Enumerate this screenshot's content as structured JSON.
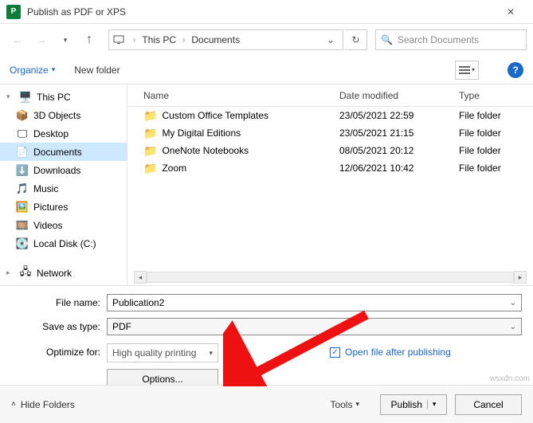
{
  "title": "Publish as PDF or XPS",
  "breadcrumb": {
    "root": "This PC",
    "folder": "Documents"
  },
  "search": {
    "placeholder": "Search Documents"
  },
  "toolbar": {
    "organize": "Organize",
    "newfolder": "New folder"
  },
  "sidebar": {
    "root": "This PC",
    "items": [
      "3D Objects",
      "Desktop",
      "Documents",
      "Downloads",
      "Music",
      "Pictures",
      "Videos",
      "Local Disk (C:)"
    ],
    "network": "Network"
  },
  "columns": {
    "name": "Name",
    "date": "Date modified",
    "type": "Type"
  },
  "files": [
    {
      "name": "Custom Office Templates",
      "date": "23/05/2021 22:59",
      "type": "File folder"
    },
    {
      "name": "My Digital Editions",
      "date": "23/05/2021 21:15",
      "type": "File folder"
    },
    {
      "name": "OneNote Notebooks",
      "date": "08/05/2021 20:12",
      "type": "File folder"
    },
    {
      "name": "Zoom",
      "date": "12/06/2021 10:42",
      "type": "File folder"
    }
  ],
  "form": {
    "filename_label": "File name:",
    "filename_value": "Publication2",
    "saveas_label": "Save as type:",
    "saveas_value": "PDF",
    "optimize_label": "Optimize for:",
    "optimize_value": "High quality printing",
    "options_btn": "Options...",
    "open_after": "Open file after publishing"
  },
  "footer": {
    "hide": "Hide Folders",
    "tools": "Tools",
    "publish": "Publish",
    "cancel": "Cancel"
  },
  "watermark": "wsxdn.com"
}
